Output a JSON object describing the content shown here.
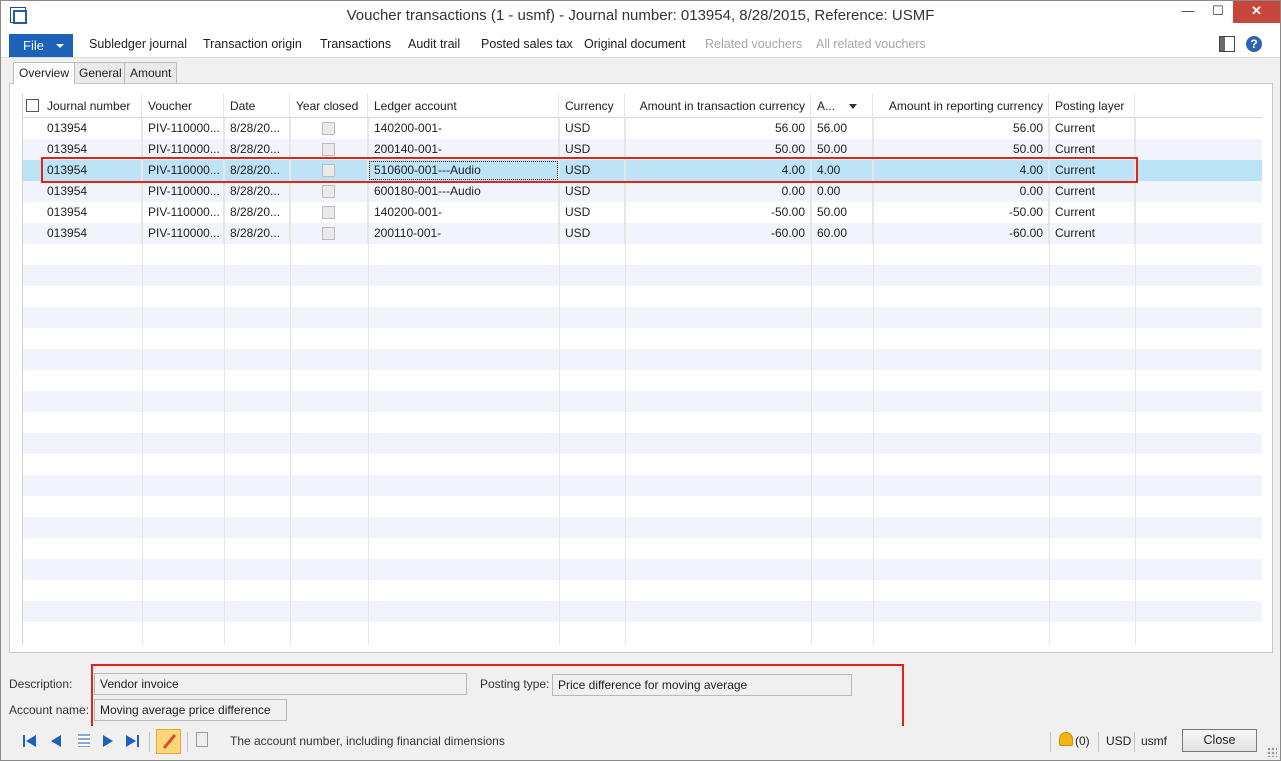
{
  "window": {
    "title": "Voucher transactions (1 - usmf) - Journal number: 013954, 8/28/2015, Reference: USMF",
    "minimize_glyph": "—",
    "maximize_glyph": "☐",
    "close_glyph": "✕"
  },
  "actionbar": {
    "file_label": "File",
    "items": [
      {
        "label": "Subledger journal",
        "enabled": true
      },
      {
        "label": "Transaction origin",
        "enabled": true
      },
      {
        "label": "Transactions",
        "enabled": true
      },
      {
        "label": "Audit trail",
        "enabled": true
      },
      {
        "label": "Posted sales tax",
        "enabled": true
      },
      {
        "label": "Original document",
        "enabled": true
      },
      {
        "label": "Related vouchers",
        "enabled": false
      },
      {
        "label": "All related vouchers",
        "enabled": false
      }
    ],
    "help_glyph": "?"
  },
  "tabs": [
    {
      "label": "Overview",
      "active": true
    },
    {
      "label": "General",
      "active": false
    },
    {
      "label": "Amount",
      "active": false
    }
  ],
  "grid": {
    "columns": [
      "Journal number",
      "Voucher",
      "Date",
      "Year closed",
      "Ledger account",
      "Currency",
      "Amount in transaction currency",
      "A...",
      "Amount in reporting currency",
      "Posting layer"
    ],
    "rows": [
      {
        "journal": "013954",
        "voucher": "PIV-110000...",
        "date": "8/28/20...",
        "ledger": "140200-001-",
        "currency": "USD",
        "amount_txn": "56.00",
        "a": "56.00",
        "amount_rep": "56.00",
        "layer": "Current",
        "selected": false
      },
      {
        "journal": "013954",
        "voucher": "PIV-110000...",
        "date": "8/28/20...",
        "ledger": "200140-001-",
        "currency": "USD",
        "amount_txn": "50.00",
        "a": "50.00",
        "amount_rep": "50.00",
        "layer": "Current",
        "selected": false
      },
      {
        "journal": "013954",
        "voucher": "PIV-110000...",
        "date": "8/28/20...",
        "ledger": "510600-001---Audio",
        "currency": "USD",
        "amount_txn": "4.00",
        "a": "4.00",
        "amount_rep": "4.00",
        "layer": "Current",
        "selected": true
      },
      {
        "journal": "013954",
        "voucher": "PIV-110000...",
        "date": "8/28/20...",
        "ledger": "600180-001---Audio",
        "currency": "USD",
        "amount_txn": "0.00",
        "a": "0.00",
        "amount_rep": "0.00",
        "layer": "Current",
        "selected": false
      },
      {
        "journal": "013954",
        "voucher": "PIV-110000...",
        "date": "8/28/20...",
        "ledger": "140200-001-",
        "currency": "USD",
        "amount_txn": "-50.00",
        "a": "50.00",
        "amount_rep": "-50.00",
        "layer": "Current",
        "selected": false
      },
      {
        "journal": "013954",
        "voucher": "PIV-110000...",
        "date": "8/28/20...",
        "ledger": "200110-001-",
        "currency": "USD",
        "amount_txn": "-60.00",
        "a": "60.00",
        "amount_rep": "-60.00",
        "layer": "Current",
        "selected": false
      }
    ]
  },
  "details": {
    "description_label": "Description:",
    "description_value": "Vendor invoice",
    "posting_type_label": "Posting type:",
    "posting_type_value": "Price difference for moving average",
    "account_name_label": "Account name:",
    "account_name_value": "Moving average price difference"
  },
  "statusbar": {
    "help_text": "The account number, including financial dimensions",
    "notifications": "(0)",
    "currency": "USD",
    "company": "usmf",
    "close_label": "Close"
  },
  "colors": {
    "accent": "#1b62b8",
    "selected_row": "#bde3f6",
    "highlight_box": "#e2231a"
  }
}
